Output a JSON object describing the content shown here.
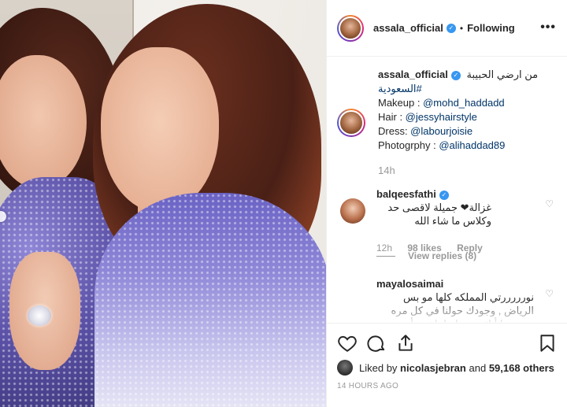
{
  "post": {
    "username": "assala_official",
    "follow_status": "Following",
    "more": "•••"
  },
  "caption": {
    "username": "assala_official",
    "arabic_text": "من ارضي الحبيبة",
    "hashtag": "#السعودية",
    "lines": [
      {
        "label": "Makeup : ",
        "link": "@mohd_haddadd"
      },
      {
        "label": "Hair : ",
        "link": "@jessyhairstyle"
      },
      {
        "label": "Dress: ",
        "link": "@labourjoisie"
      },
      {
        "label": "Photogrphy : ",
        "link": "@alihaddad89"
      }
    ],
    "time": "14h"
  },
  "comments": [
    {
      "username": "balqeesfathi",
      "text": "غزالة❤ جميلة لاقصى حد وكلاس ما شاء الله",
      "time": "12h",
      "likes": "98 likes",
      "reply": "Reply"
    },
    {
      "username": "mayalosaimai",
      "text": "نورررررتي المملكه كلها مو بس الرياض , وجودك حولنا في كل مره يحسسنا أنك بنت بلدنا، اعجز أوصف حبي لك"
    }
  ],
  "view_replies": "View replies (8)",
  "likes": {
    "liked_by_prefix": "Liked by ",
    "liked_by_user": "nicolasjebran",
    "and_text": " and ",
    "others": "59,168 others"
  },
  "timestamp": "14 HOURS AGO",
  "icons": {
    "like": "heart-outline-icon",
    "comment": "comment-bubble-icon",
    "share": "share-upload-icon",
    "save": "bookmark-icon",
    "verified": "verified-badge-icon"
  },
  "colors": {
    "link": "#003569",
    "verified": "#3897f0",
    "muted": "#999999"
  }
}
